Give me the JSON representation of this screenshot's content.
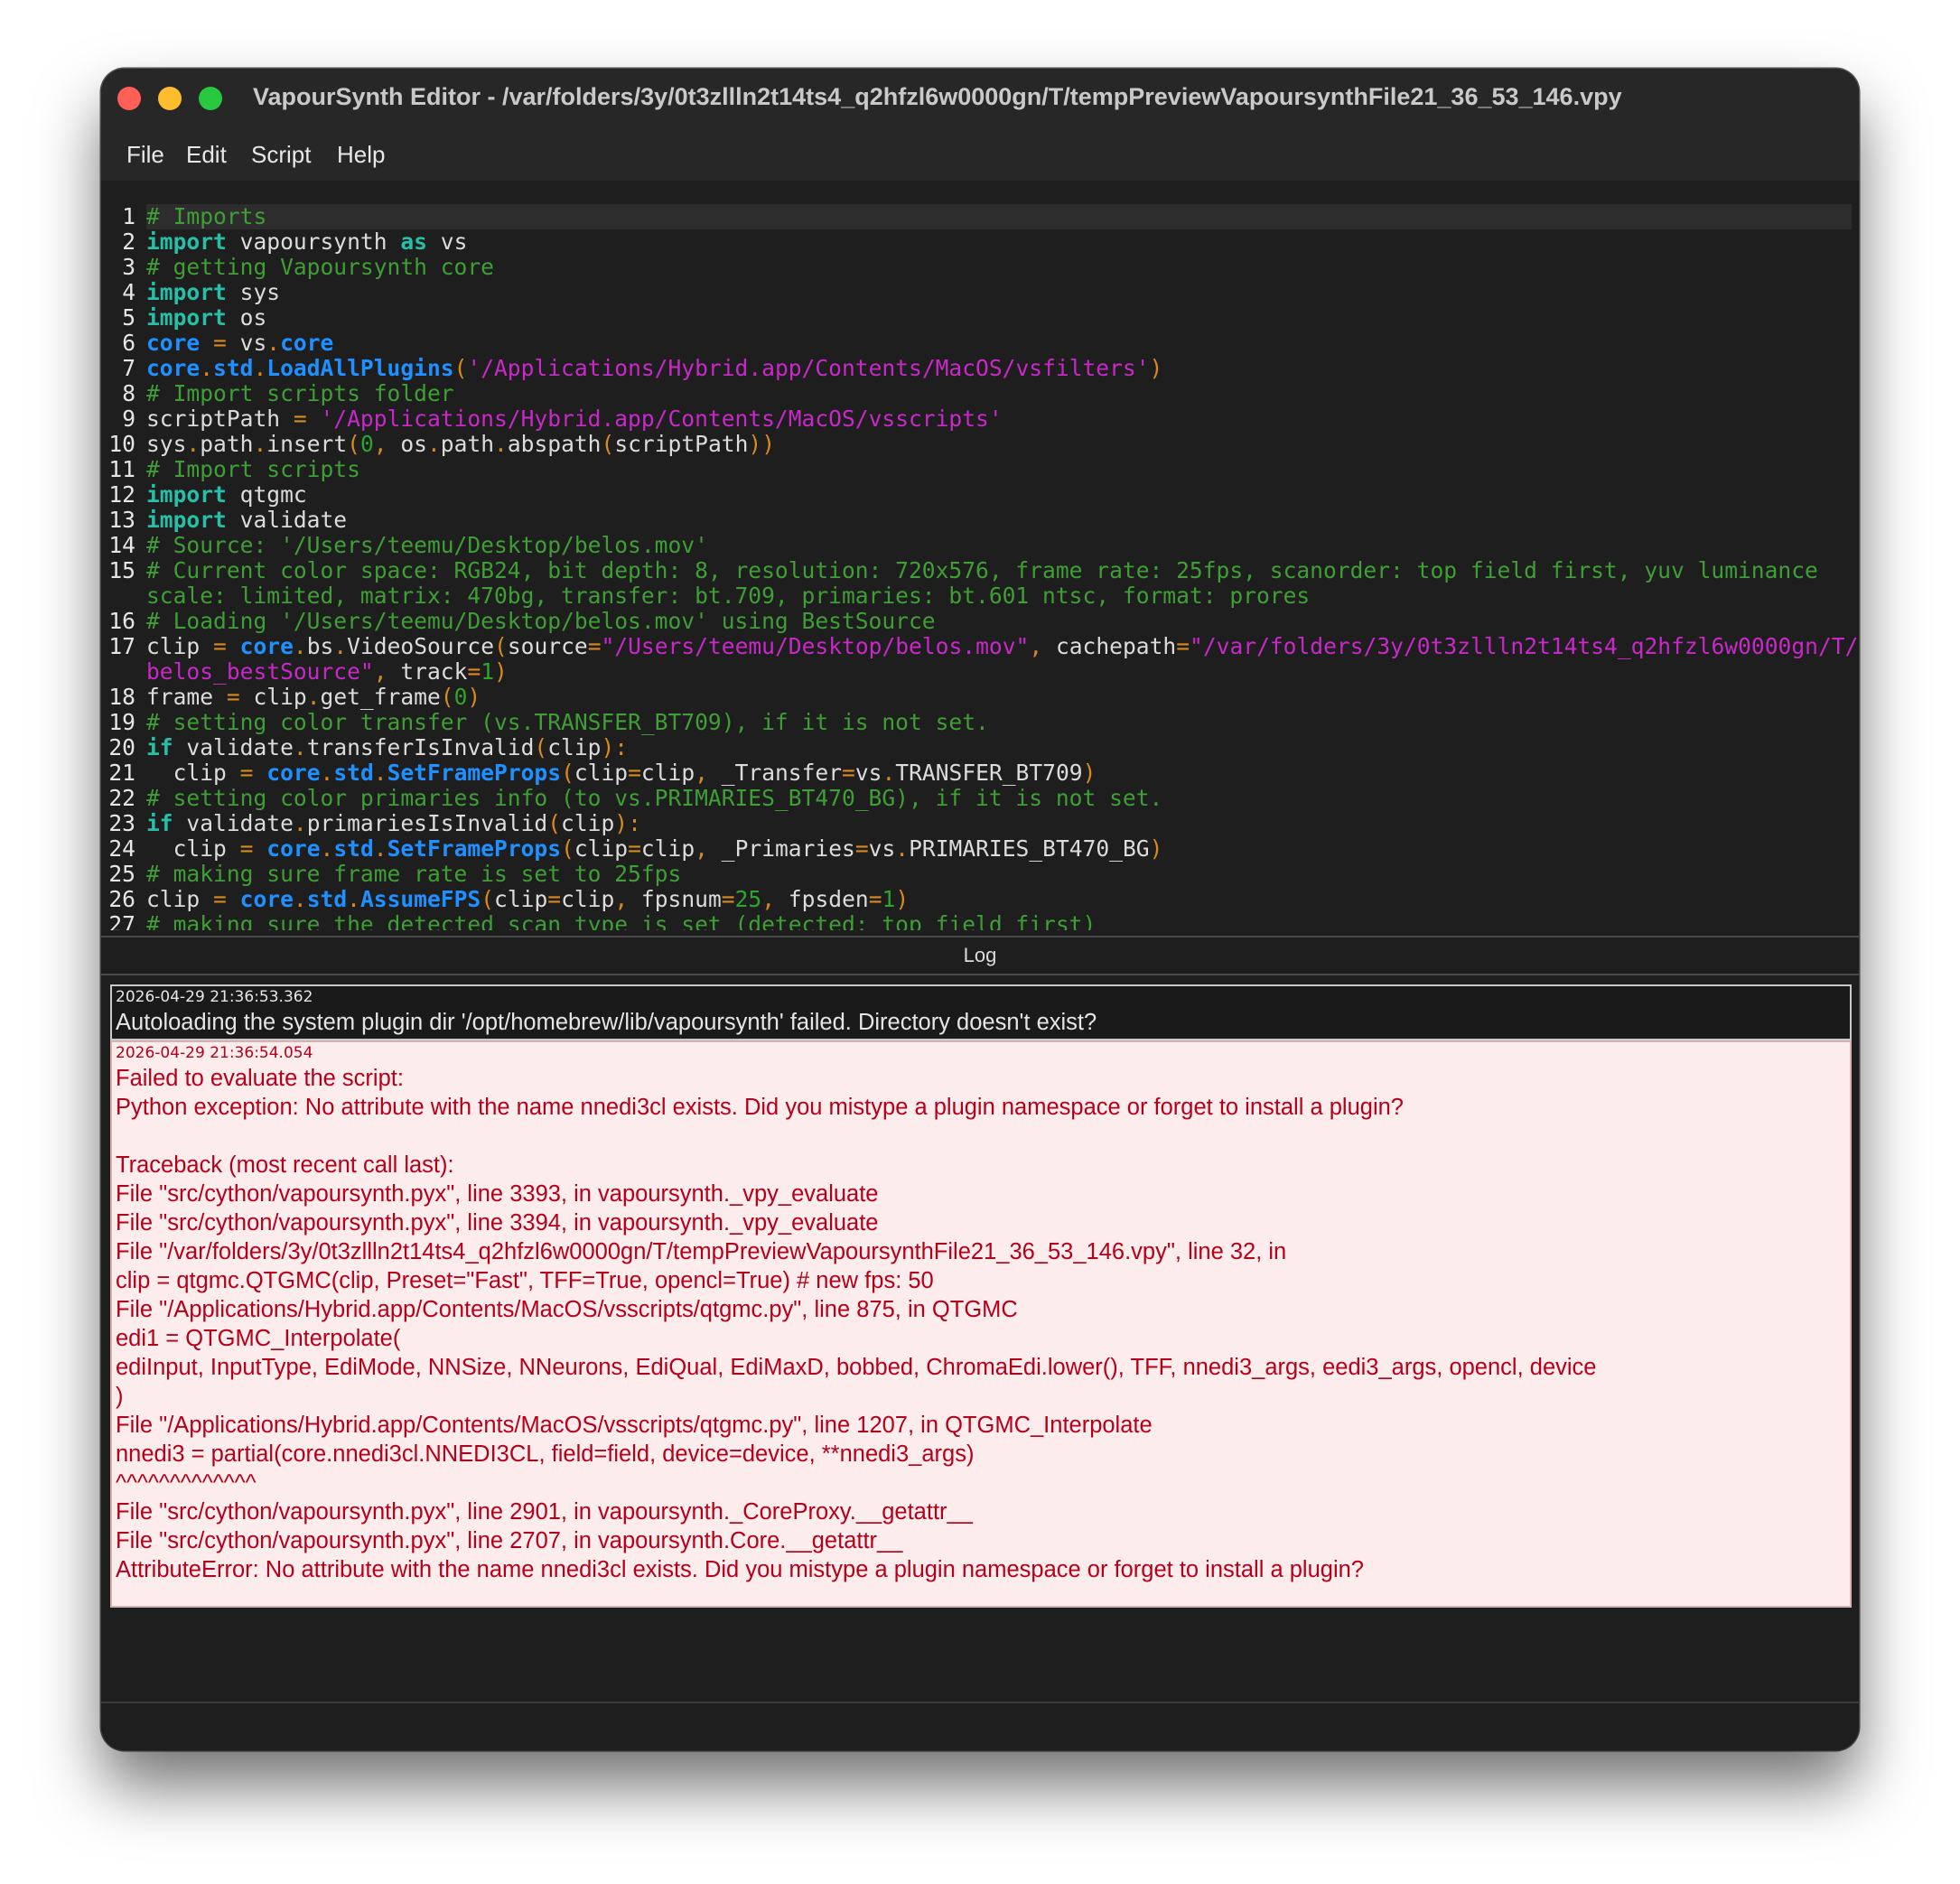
{
  "window": {
    "title": "VapourSynth Editor - /var/folders/3y/0t3zllln2t14ts4_q2hfzl6w0000gn/T/tempPreviewVapoursynthFile21_36_53_146.vpy"
  },
  "menu": {
    "file": "File",
    "edit": "Edit",
    "script": "Script",
    "help": "Help"
  },
  "editor": {
    "lines": [
      {
        "n": "1",
        "html": "<span class='cm'># Imports</span>"
      },
      {
        "n": "2",
        "html": "<span class='kw'>import</span> vapoursynth <span class='kw'>as</span> vs"
      },
      {
        "n": "3",
        "html": "<span class='cm'># getting Vapoursynth core</span>"
      },
      {
        "n": "4",
        "html": "<span class='kw'>import</span> sys"
      },
      {
        "n": "5",
        "html": "<span class='kw'>import</span> os"
      },
      {
        "n": "6",
        "html": "<span class='sy'>core</span> <span class='op'>=</span> vs<span class='op'>.</span><span class='sy'>core</span>"
      },
      {
        "n": "7",
        "html": "<span class='sy'>core</span><span class='op'>.</span><span class='sy'>std</span><span class='op'>.</span><span class='sy'>LoadAllPlugins</span><span class='op'>(</span><span class='st'>'/Applications/Hybrid.app/Contents/MacOS/vsfilters'</span><span class='op'>)</span>"
      },
      {
        "n": "8",
        "html": "<span class='cm'># Import scripts folder</span>"
      },
      {
        "n": "9",
        "html": "scriptPath <span class='op'>=</span> <span class='st'>'/Applications/Hybrid.app/Contents/MacOS/vsscripts'</span>"
      },
      {
        "n": "10",
        "html": "sys<span class='op'>.</span>path<span class='op'>.</span>insert<span class='op'>(</span><span class='nm'>0</span><span class='op'>,</span> os<span class='op'>.</span>path<span class='op'>.</span>abspath<span class='op'>(</span>scriptPath<span class='op'>))</span>"
      },
      {
        "n": "11",
        "html": "<span class='cm'># Import scripts</span>"
      },
      {
        "n": "12",
        "html": "<span class='kw'>import</span> qtgmc"
      },
      {
        "n": "13",
        "html": "<span class='kw'>import</span> validate"
      },
      {
        "n": "14",
        "html": "<span class='cm'># Source: '/Users/teemu/Desktop/belos.mov'</span>"
      },
      {
        "n": "15",
        "html": "<span class='cm'># Current color space: RGB24, bit depth: 8, resolution: 720x576, frame rate: 25fps, scanorder: top field first, yuv luminance</span>"
      },
      {
        "n": "",
        "html": "<span class='cm'>scale: limited, matrix: 470bg, transfer: bt.709, primaries: bt.601 ntsc, format: prores</span>"
      },
      {
        "n": "16",
        "html": "<span class='cm'># Loading '/Users/teemu/Desktop/belos.mov' using BestSource</span>"
      },
      {
        "n": "17",
        "html": "clip <span class='op'>=</span> <span class='sy'>core</span><span class='op'>.</span>bs<span class='op'>.</span>VideoSource<span class='op'>(</span>source<span class='op'>=</span><span class='st'>\"/Users/teemu/Desktop/belos.mov\"</span><span class='op'>,</span> cachepath<span class='op'>=</span><span class='st'>\"/var/folders/3y/0t3zllln2t14ts4_q2hfzl6w0000gn/T/</span>"
      },
      {
        "n": "",
        "html": "<span class='st'>belos_bestSource\"</span><span class='op'>,</span> track<span class='op'>=</span><span class='nm'>1</span><span class='op'>)</span>"
      },
      {
        "n": "18",
        "html": "frame <span class='op'>=</span> clip<span class='op'>.</span>get_frame<span class='op'>(</span><span class='nm'>0</span><span class='op'>)</span>"
      },
      {
        "n": "19",
        "html": "<span class='cm'># setting color transfer (vs.TRANSFER_BT709), if it is not set.</span>"
      },
      {
        "n": "20",
        "html": "<span class='kw'>if</span> validate<span class='op'>.</span>transferIsInvalid<span class='op'>(</span>clip<span class='op'>):</span>"
      },
      {
        "n": "21",
        "html": "  clip <span class='op'>=</span> <span class='sy'>core</span><span class='op'>.</span><span class='sy'>std</span><span class='op'>.</span><span class='sy'>SetFrameProps</span><span class='op'>(</span>clip<span class='op'>=</span>clip<span class='op'>,</span> _Transfer<span class='op'>=</span>vs<span class='op'>.</span>TRANSFER_BT709<span class='op'>)</span>"
      },
      {
        "n": "22",
        "html": "<span class='cm'># setting color primaries info (to vs.PRIMARIES_BT470_BG), if it is not set.</span>"
      },
      {
        "n": "23",
        "html": "<span class='kw'>if</span> validate<span class='op'>.</span>primariesIsInvalid<span class='op'>(</span>clip<span class='op'>):</span>"
      },
      {
        "n": "24",
        "html": "  clip <span class='op'>=</span> <span class='sy'>core</span><span class='op'>.</span><span class='sy'>std</span><span class='op'>.</span><span class='sy'>SetFrameProps</span><span class='op'>(</span>clip<span class='op'>=</span>clip<span class='op'>,</span> _Primaries<span class='op'>=</span>vs<span class='op'>.</span>PRIMARIES_BT470_BG<span class='op'>)</span>"
      },
      {
        "n": "25",
        "html": "<span class='cm'># making sure frame rate is set to 25fps</span>"
      },
      {
        "n": "26",
        "html": "clip <span class='op'>=</span> <span class='sy'>core</span><span class='op'>.</span><span class='sy'>std</span><span class='op'>.</span><span class='sy'>AssumeFPS</span><span class='op'>(</span>clip<span class='op'>=</span>clip<span class='op'>,</span> fpsnum<span class='op'>=</span><span class='nm'>25</span><span class='op'>,</span> fpsden<span class='op'>=</span><span class='nm'>1</span><span class='op'>)</span>"
      },
      {
        "n": "27",
        "html": "<span class='cm'># making sure the detected scan type is set (detected: top field first)</span>"
      }
    ]
  },
  "log": {
    "title": "Log",
    "entries": [
      {
        "timestamp": "2026-04-29 21:36:53.362",
        "message": "Autoloading the system plugin dir '/opt/homebrew/lib/vapoursynth' failed. Directory doesn't exist?"
      },
      {
        "timestamp": "2026-04-29 21:36:54.054",
        "message": "Failed to evaluate the script:\nPython exception: No attribute with the name nnedi3cl exists. Did you mistype a plugin namespace or forget to install a plugin?\n\nTraceback (most recent call last):\nFile \"src/cython/vapoursynth.pyx\", line 3393, in vapoursynth._vpy_evaluate\nFile \"src/cython/vapoursynth.pyx\", line 3394, in vapoursynth._vpy_evaluate\nFile \"/var/folders/3y/0t3zllln2t14ts4_q2hfzl6w0000gn/T/tempPreviewVapoursynthFile21_36_53_146.vpy\", line 32, in\nclip = qtgmc.QTGMC(clip, Preset=\"Fast\", TFF=True, opencl=True) # new fps: 50\nFile \"/Applications/Hybrid.app/Contents/MacOS/vsscripts/qtgmc.py\", line 875, in QTGMC\nedi1 = QTGMC_Interpolate(\nediInput, InputType, EdiMode, NNSize, NNeurons, EdiQual, EdiMaxD, bobbed, ChromaEdi.lower(), TFF, nnedi3_args, eedi3_args, opencl, device\n)\nFile \"/Applications/Hybrid.app/Contents/MacOS/vsscripts/qtgmc.py\", line 1207, in QTGMC_Interpolate\nnnedi3 = partial(core.nnedi3cl.NNEDI3CL, field=field, device=device, **nnedi3_args)\n^^^^^^^^^^^^^\nFile \"src/cython/vapoursynth.pyx\", line 2901, in vapoursynth._CoreProxy.__getattr__\nFile \"src/cython/vapoursynth.pyx\", line 2707, in vapoursynth.Core.__getattr__\nAttributeError: No attribute with the name nnedi3cl exists. Did you mistype a plugin namespace or forget to install a plugin?"
      }
    ]
  },
  "colors": {
    "error_text": "#b5001b",
    "error_bg": "#fdecec",
    "keyword": "#26bfa8",
    "comment": "#3f9e35",
    "string": "#c928c9"
  }
}
